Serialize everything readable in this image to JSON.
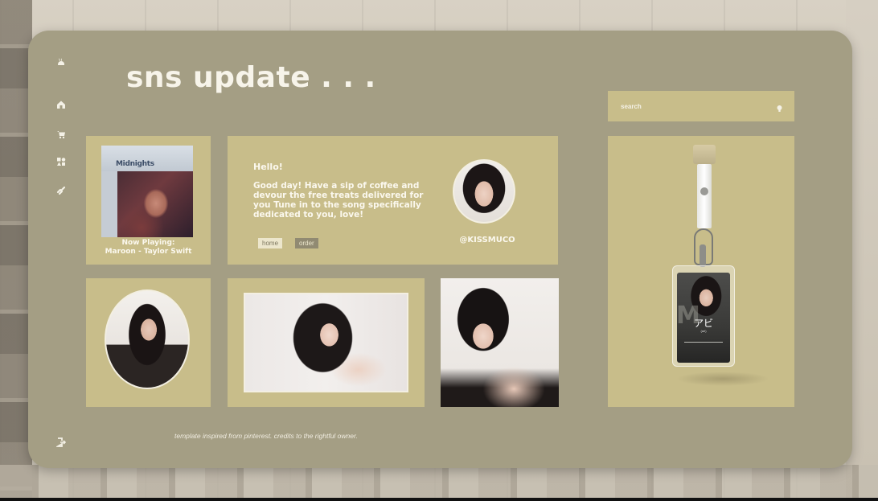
{
  "header": {
    "title": "sns update . . ."
  },
  "search": {
    "placeholder": "search"
  },
  "sidebar": {
    "icons": [
      "rabbit-icon",
      "home-icon",
      "cart-icon",
      "shapes-icon",
      "link-icon"
    ],
    "bottom_icon": "logout-icon"
  },
  "now_playing": {
    "album_title": "Midnights",
    "label": "Now Playing:",
    "track": "Maroon - Taylor Swift"
  },
  "message": {
    "greeting": "Hello!",
    "body": "Good day! Have a sip of coffee and devour the free treats delivered for you Tune in to the song specifically dedicated to you, love!",
    "buttons": {
      "home": "home",
      "order": "order"
    },
    "handle": "@KISSMUCO"
  },
  "badge": {
    "name": "アビ",
    "sub": "(ari)"
  },
  "footer": {
    "credits": "template inspired from pinterest. credits to the rightful owner."
  },
  "colors": {
    "panel": "#a49e84",
    "card": "#c8bd8a",
    "text": "#fbf8ee"
  }
}
